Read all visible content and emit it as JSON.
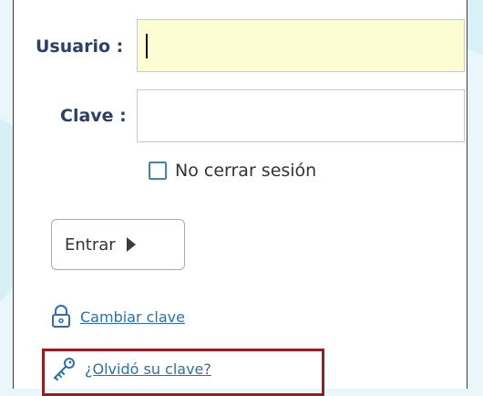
{
  "login_form": {
    "username_label": "Usuario :",
    "username_value": "",
    "password_label": "Clave :",
    "password_value": "",
    "keep_session_label": "No cerrar sesión",
    "keep_session_checked": false,
    "enter_button_label": "Entrar",
    "change_password_link": "Cambiar clave",
    "forgot_password_link": "¿Olvidó su clave?"
  },
  "colors": {
    "label_color": "#2a3f6e",
    "link_color": "#2c6fb6",
    "username_field_bg": "#fdfdd4",
    "checkbox_border": "#3a86c8",
    "highlight_border": "#9b1b22",
    "background": "#e9f7fb"
  },
  "icons": {
    "enter_button": "play-arrow-icon",
    "change_password": "lock-icon",
    "forgot_password": "key-icon"
  }
}
